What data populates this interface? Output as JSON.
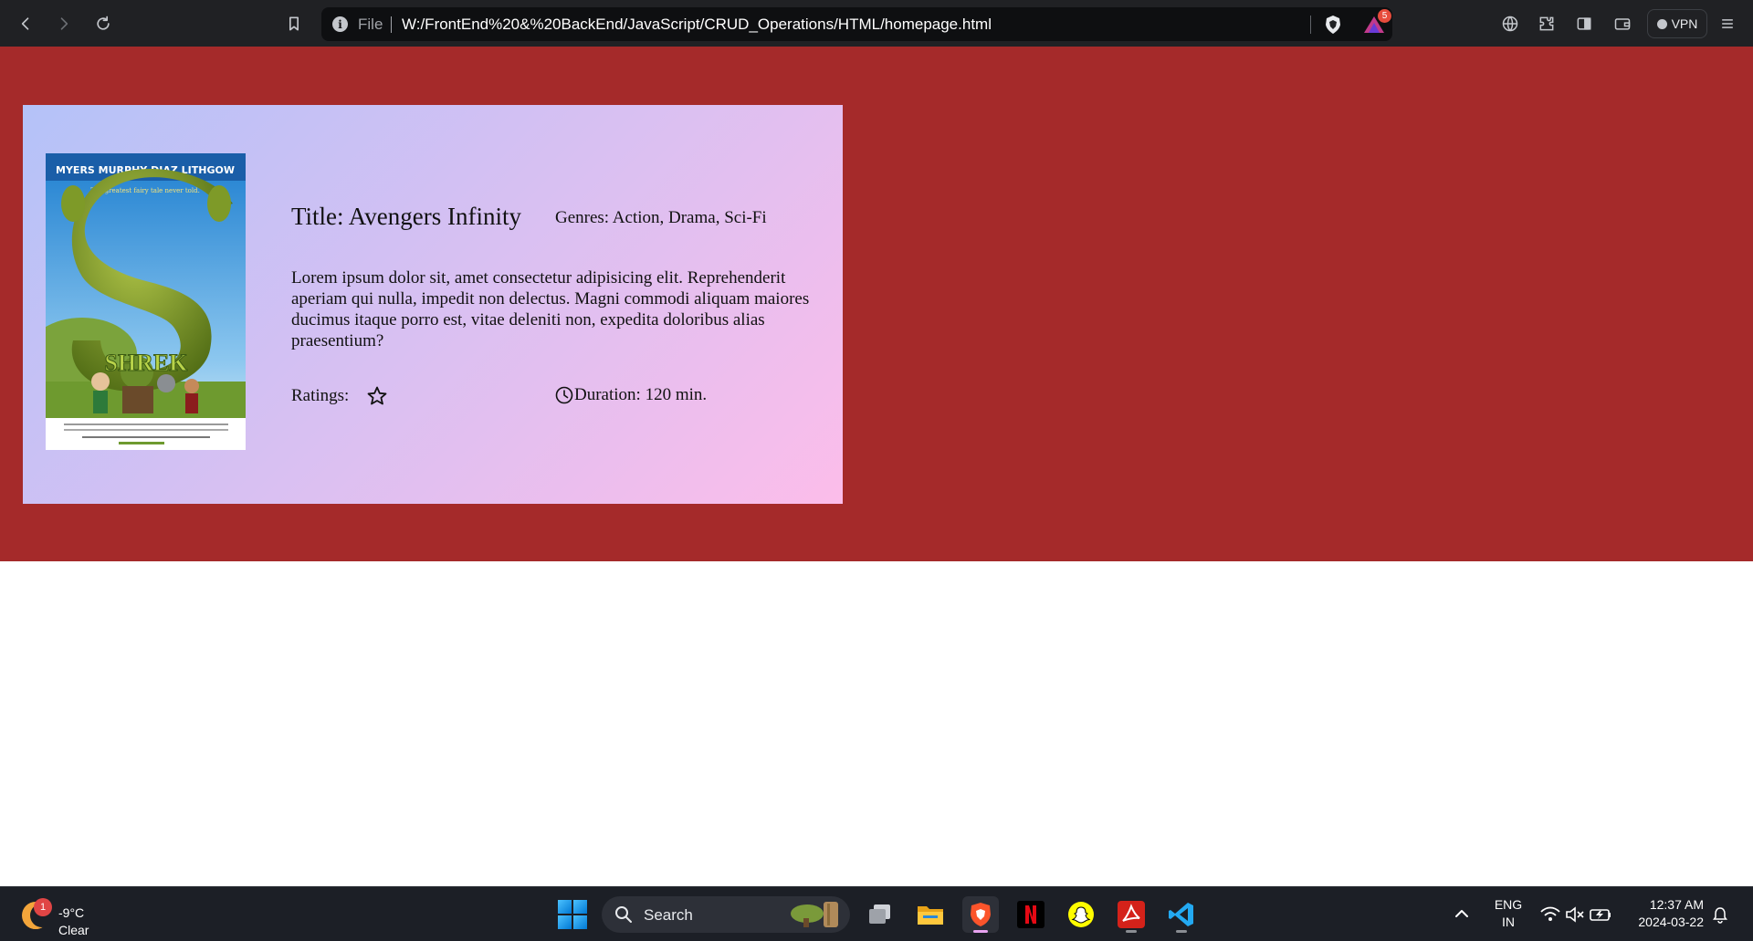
{
  "browser": {
    "url_scheme": "File",
    "url": "W:/FrontEnd%20&%20BackEnd/JavaScript/CRUD_Operations/HTML/homepage.html",
    "rewards_badge": "5",
    "vpn_label": "VPN"
  },
  "page": {
    "background_color": "#a52a2a",
    "card": {
      "poster": {
        "top_credits": [
          "MYERS",
          "MURPHY",
          "DIAZ",
          "LITHGOW"
        ],
        "tagline": "The greatest fairy tale never told.",
        "wordmark": "SHREK"
      },
      "title": "Title: Avengers Infinity",
      "genres": "Genres: Action, Drama, Sci-Fi",
      "description": "Lorem ipsum dolor sit, amet consectetur adipisicing elit. Reprehenderit aperiam qui nulla, impedit non delectus. Magni commodi aliquam maiores ducimus itaque porro est, vitae deleniti non, expedita doloribus alias praesentium?",
      "ratings_label": "Ratings:",
      "duration": "Duration: 120 min."
    }
  },
  "taskbar": {
    "weather_badge": "1",
    "temperature": "-9°C",
    "condition": "Clear",
    "search_label": "Search",
    "lang_line1": "ENG",
    "lang_line2": "IN",
    "time": "12:37 AM",
    "date": "2024-03-22"
  }
}
